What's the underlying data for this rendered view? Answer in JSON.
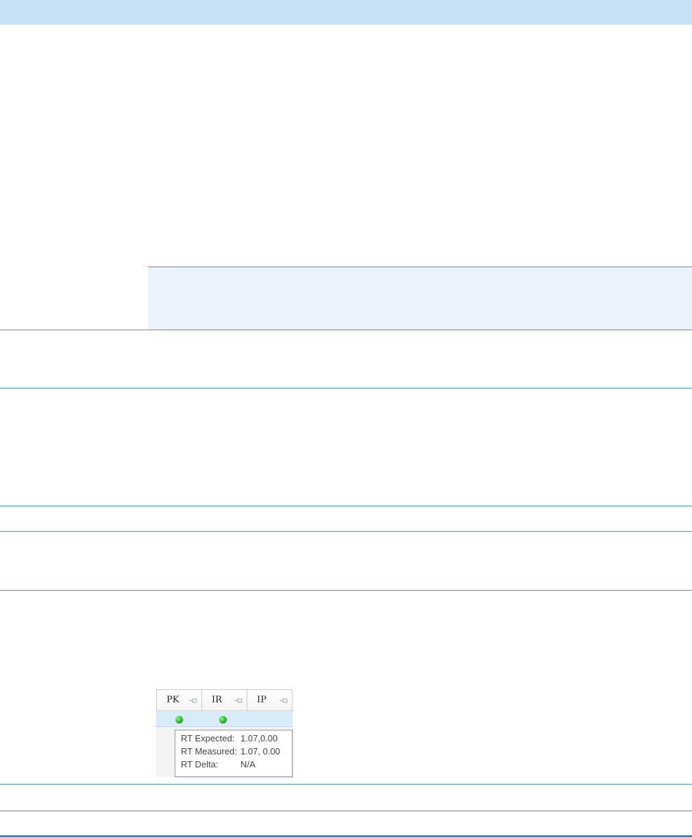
{
  "widget": {
    "columns": [
      {
        "label": "PK",
        "icon": "pin-icon"
      },
      {
        "label": "IR",
        "icon": "pin-icon"
      },
      {
        "label": "IP",
        "icon": "pin-icon"
      }
    ],
    "status_indicators": [
      {
        "column": "PK",
        "color": "#2fc12a",
        "state": "ok"
      },
      {
        "column": "IR",
        "color": "#2fc12a",
        "state": "ok"
      }
    ],
    "tooltip": {
      "rows": [
        {
          "label": "RT Expected:",
          "value": "1.07,0.00"
        },
        {
          "label": "RT Measured:",
          "value": "1.07, 0.00"
        },
        {
          "label": "RT Delta:",
          "value": "N/A"
        }
      ]
    }
  },
  "colors": {
    "header_band": "#c6e0f5",
    "rule": "#4a90d6",
    "shaded_panel": "#eaf3fb"
  }
}
